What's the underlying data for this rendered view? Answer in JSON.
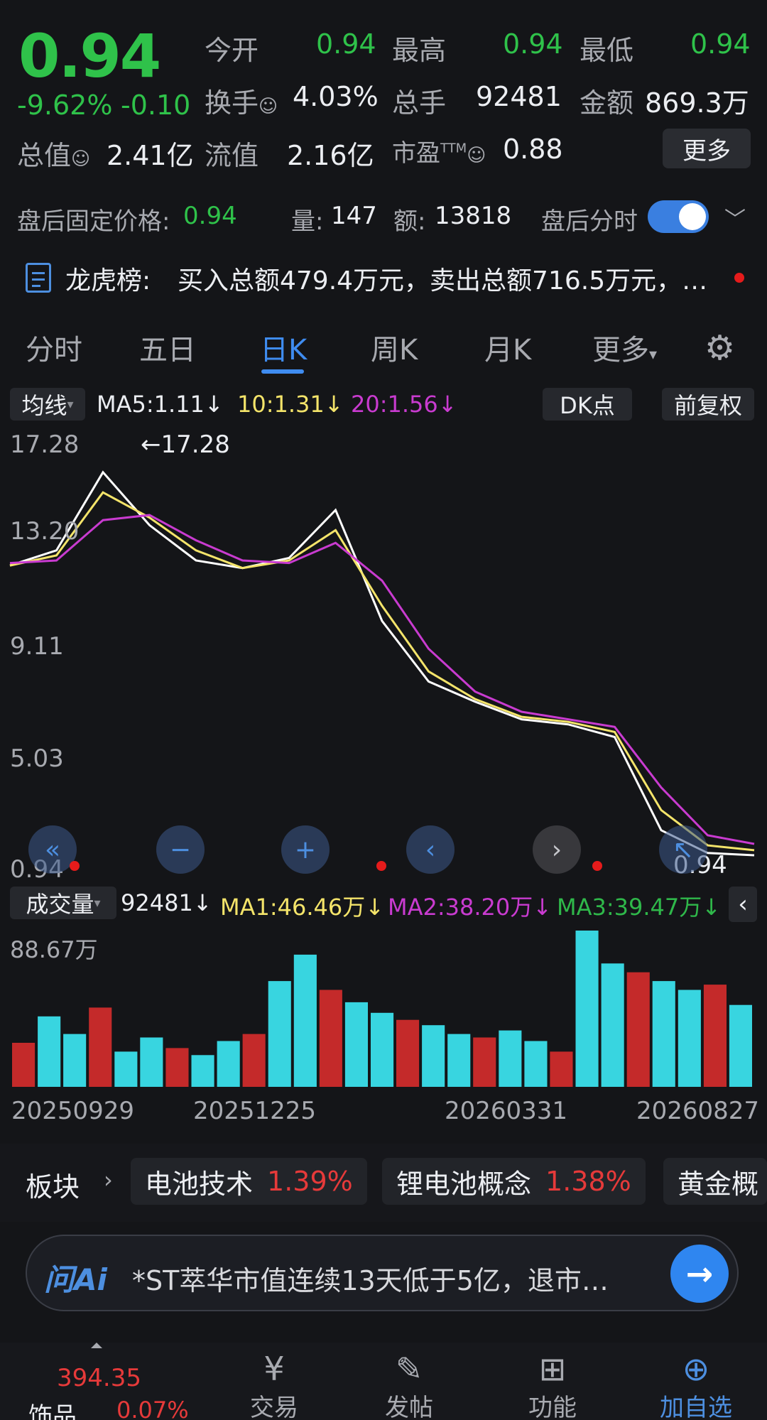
{
  "quote": {
    "price": "0.94",
    "change_pct": "-9.62%",
    "change": "-0.10",
    "open_label": "今开",
    "open": "0.94",
    "high_label": "最高",
    "high": "0.94",
    "low_label": "最低",
    "low": "0.94",
    "turnover_label": "换手",
    "turnover": "4.03%",
    "volume_label": "总手",
    "volume": "92481",
    "amount_label": "金额",
    "amount": "869.3万",
    "mktcap_label": "总值",
    "mktcap": "2.41亿",
    "float_label": "流值",
    "float": "2.16亿",
    "pe_label": "市盈",
    "pe_sup": "TTM",
    "pe": "0.88",
    "more": "更多"
  },
  "after_hours": {
    "label": "盘后固定价格:",
    "price": "0.94",
    "vol_label": "量:",
    "vol": "147",
    "amt_label": "额:",
    "amt": "13818",
    "timeshare_label": "盘后分时"
  },
  "dragon_tiger": {
    "label": "龙虎榜:",
    "text": "买入总额479.4万元，卖出总额716.5万元，…"
  },
  "tabs": [
    "分时",
    "五日",
    "日K",
    "周K",
    "月K",
    "更多"
  ],
  "ma_bar": {
    "selector": "均线",
    "ma5": "MA5:1.11",
    "ma10": "10:1.31",
    "ma20": "20:1.56",
    "dk": "DK点",
    "adjust": "前复权"
  },
  "price_axis": [
    "17.28",
    "13.20",
    "9.11",
    "5.03",
    "0.94"
  ],
  "price_annotations": {
    "high": "←17.28",
    "last": "0.94"
  },
  "volume_bar": {
    "selector": "成交量",
    "vol": "92481",
    "ma1": "MA1:46.46万",
    "ma2": "MA2:38.20万",
    "ma3": "MA3:39.47万",
    "axis_max": "88.67万"
  },
  "date_axis": [
    "20250929",
    "20251225",
    "20260331",
    "20260827"
  ],
  "sector_label": "板块",
  "sectors": [
    {
      "name": "电池技术",
      "pct": "1.39%"
    },
    {
      "name": "锂电池概念",
      "pct": "1.38%"
    },
    {
      "name": "黄金概",
      "pct": ""
    }
  ],
  "ai": {
    "logo": "问Ai",
    "text": "*ST萃华市值连续13天低于5亿，退市…"
  },
  "bottom_nav": {
    "index_value": "394.35",
    "index_name": "饰品",
    "index_pct": "0.07%",
    "items": [
      "交易",
      "发帖",
      "功能",
      "加自选"
    ]
  },
  "colors": {
    "up": "#e63a3a",
    "down": "#2fc24a",
    "accent": "#3f8cf0",
    "ma5": "#ffffff",
    "ma10": "#f4e46a",
    "ma20": "#c93bd0",
    "vol_up": "#c42a2a",
    "vol_down": "#38d5e0",
    "ma3": "#2fb84a"
  },
  "chart_data": {
    "type": "line",
    "title": "",
    "x": [
      "20250929",
      "20251225",
      "20260331",
      "20260827"
    ],
    "ylim": [
      0.94,
      17.28
    ],
    "series": [
      {
        "name": "MA5",
        "values": [
          12.6,
          13.2,
          16.3,
          14.2,
          12.8,
          12.5,
          12.9,
          14.8,
          10.4,
          8.0,
          7.2,
          6.5,
          6.3,
          5.8,
          2.1,
          1.2,
          1.11
        ]
      },
      {
        "name": "10",
        "values": [
          12.6,
          13.0,
          15.5,
          14.5,
          13.2,
          12.5,
          12.8,
          14.0,
          11.0,
          8.4,
          7.3,
          6.6,
          6.4,
          6.0,
          2.9,
          1.5,
          1.31
        ]
      },
      {
        "name": "20",
        "values": [
          12.7,
          12.8,
          14.4,
          14.6,
          13.6,
          12.8,
          12.7,
          13.5,
          12.0,
          9.3,
          7.6,
          6.8,
          6.5,
          6.2,
          3.8,
          1.9,
          1.56
        ]
      }
    ],
    "volume": {
      "ylim": [
        0,
        88.67
      ],
      "unit": "万",
      "values": [
        25,
        40,
        30,
        45,
        20,
        28,
        22,
        18,
        26,
        30,
        60,
        75,
        55,
        48,
        42,
        38,
        35,
        30,
        28,
        32,
        26,
        20,
        88.67,
        70,
        65,
        60,
        55,
        58,
        46.46
      ]
    }
  }
}
